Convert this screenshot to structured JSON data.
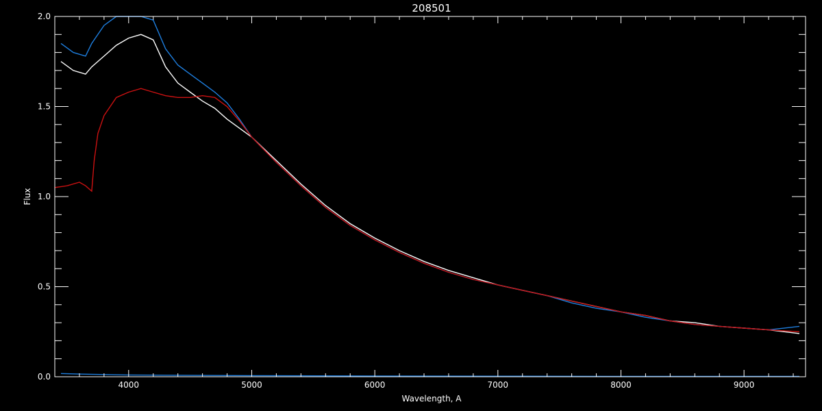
{
  "chart_data": {
    "type": "line",
    "title": "208501",
    "xlabel": "Wavelength, A",
    "ylabel": "Flux",
    "xlim": [
      3400,
      9500
    ],
    "ylim": [
      0.0,
      2.0
    ],
    "grid": false,
    "x_ticks": [
      4000,
      5000,
      6000,
      7000,
      8000,
      9000
    ],
    "x_tick_labels": [
      "4000",
      "5000",
      "6000",
      "7000",
      "8000",
      "9000"
    ],
    "y_ticks": [
      0.0,
      0.5,
      1.0,
      1.5,
      2.0
    ],
    "y_tick_labels": [
      "0.0",
      "0.5",
      "1.0",
      "1.5",
      "2.0"
    ],
    "series": [
      {
        "color": "#ffffff",
        "x": [
          3450,
          3550,
          3650,
          3700,
          3800,
          3900,
          4000,
          4100,
          4200,
          4300,
          4400,
          4500,
          4600,
          4700,
          4800,
          4900,
          5000,
          5200,
          5400,
          5600,
          5800,
          6000,
          6200,
          6400,
          6600,
          6800,
          7000,
          7200,
          7400,
          7600,
          7800,
          8000,
          8200,
          8400,
          8600,
          8800,
          9000,
          9200,
          9450
        ],
        "y": [
          1.75,
          1.7,
          1.68,
          1.72,
          1.78,
          1.84,
          1.88,
          1.9,
          1.87,
          1.72,
          1.63,
          1.58,
          1.53,
          1.49,
          1.43,
          1.38,
          1.33,
          1.2,
          1.07,
          0.95,
          0.85,
          0.77,
          0.7,
          0.64,
          0.59,
          0.55,
          0.51,
          0.48,
          0.45,
          0.42,
          0.39,
          0.36,
          0.34,
          0.31,
          0.3,
          0.28,
          0.27,
          0.26,
          0.24
        ]
      },
      {
        "color": "#1e7fe0",
        "x": [
          3450,
          3550,
          3650,
          3700,
          3800,
          3900,
          4000,
          4100,
          4200,
          4300,
          4400,
          4500,
          4600,
          4700,
          4800,
          4900,
          5000,
          5200,
          5400,
          5600,
          5800,
          6000,
          6200,
          6400,
          6600,
          6800,
          7000,
          7200,
          7400,
          7600,
          7800,
          8000,
          8200,
          8400,
          8600,
          8800,
          9000,
          9200,
          9450
        ],
        "y": [
          1.85,
          1.8,
          1.78,
          1.85,
          1.95,
          2.0,
          2.0,
          2.0,
          1.98,
          1.82,
          1.73,
          1.68,
          1.63,
          1.58,
          1.52,
          1.43,
          1.33,
          1.19,
          1.06,
          0.94,
          0.84,
          0.76,
          0.69,
          0.63,
          0.58,
          0.54,
          0.51,
          0.48,
          0.45,
          0.41,
          0.38,
          0.36,
          0.33,
          0.31,
          0.29,
          0.28,
          0.27,
          0.26,
          0.28
        ]
      },
      {
        "color": "#cc1111",
        "x": [
          3400,
          3500,
          3600,
          3650,
          3700,
          3720,
          3750,
          3800,
          3850,
          3900,
          4000,
          4100,
          4200,
          4300,
          4400,
          4500,
          4600,
          4700,
          4800,
          4900,
          5000,
          5200,
          5400,
          5600,
          5800,
          6000,
          6200,
          6400,
          6600,
          6800,
          7000,
          7200,
          7400,
          7600,
          7800,
          8000,
          8200,
          8400,
          8600,
          8800,
          9000,
          9200,
          9450
        ],
        "y": [
          1.05,
          1.06,
          1.08,
          1.06,
          1.03,
          1.2,
          1.35,
          1.45,
          1.5,
          1.55,
          1.58,
          1.6,
          1.58,
          1.56,
          1.55,
          1.55,
          1.56,
          1.55,
          1.5,
          1.42,
          1.33,
          1.19,
          1.06,
          0.94,
          0.84,
          0.76,
          0.69,
          0.63,
          0.58,
          0.54,
          0.51,
          0.48,
          0.45,
          0.42,
          0.39,
          0.36,
          0.34,
          0.31,
          0.29,
          0.28,
          0.27,
          0.26,
          0.25
        ]
      },
      {
        "color": "#1e7fe0",
        "x": [
          3450,
          3600,
          4000,
          5000,
          6000,
          7000,
          8000,
          9000,
          9450
        ],
        "y": [
          0.018,
          0.015,
          0.01,
          0.006,
          0.004,
          0.003,
          0.002,
          0.002,
          0.002
        ]
      }
    ]
  }
}
